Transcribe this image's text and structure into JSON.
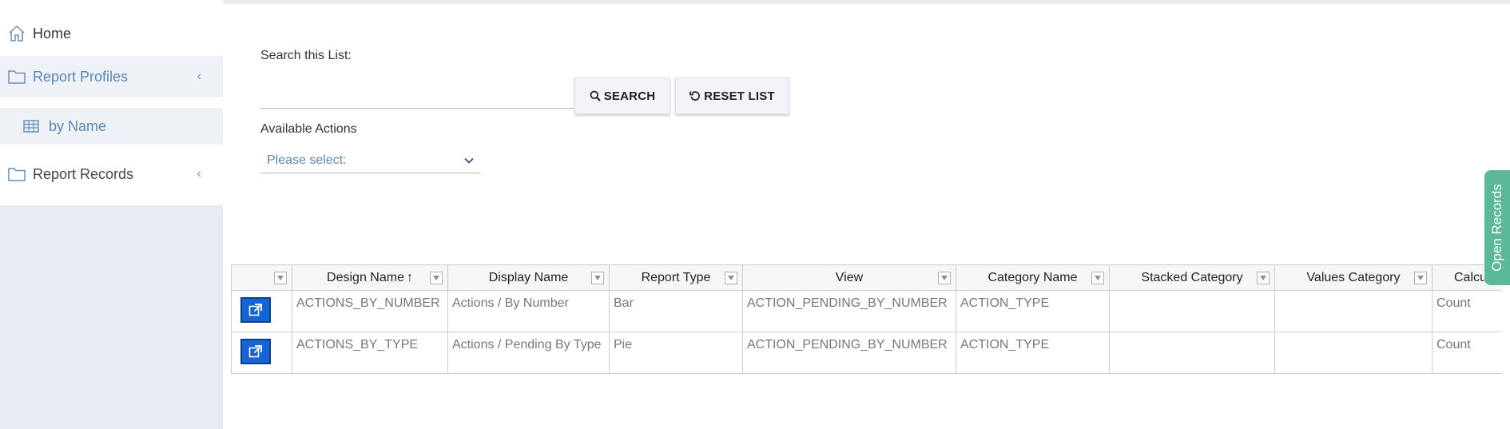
{
  "sidebar": {
    "home": "Home",
    "report_profiles": "Report Profiles",
    "by_name": "by Name",
    "report_records": "Report Records"
  },
  "search": {
    "label": "Search this List:",
    "value": "",
    "search_button": "SEARCH",
    "reset_button": "RESET LIST"
  },
  "actions": {
    "label": "Available Actions",
    "selected": "Please select:"
  },
  "grid": {
    "columns": [
      "",
      "Design Name",
      "Display Name",
      "Report Type",
      "View",
      "Category Name",
      "Stacked Category",
      "Values Category",
      "Calcu"
    ],
    "sort_indicator": "↑",
    "rows": [
      [
        "ACTIONS_BY_NUMBER",
        "Actions / By Number",
        "Bar",
        "ACTION_PENDING_BY_NUMBER",
        "ACTION_TYPE",
        "",
        "",
        "Count"
      ],
      [
        "ACTIONS_BY_TYPE",
        "Actions / Pending By Type",
        "Pie",
        "ACTION_PENDING_BY_NUMBER",
        "ACTION_TYPE",
        "",
        "",
        "Count"
      ]
    ]
  },
  "side_tab": {
    "label": "Open Records"
  },
  "colors": {
    "accent": "#5a88b8",
    "open_button": "#1565d8",
    "side_tab": "#5cb89a",
    "sidebar_bg": "#e9ebf3"
  },
  "icons": [
    "home-icon",
    "folder-icon",
    "table-icon",
    "chevron-left-icon",
    "search-icon",
    "reset-icon",
    "chevron-down-icon",
    "filter-icon",
    "open-record-icon"
  ]
}
